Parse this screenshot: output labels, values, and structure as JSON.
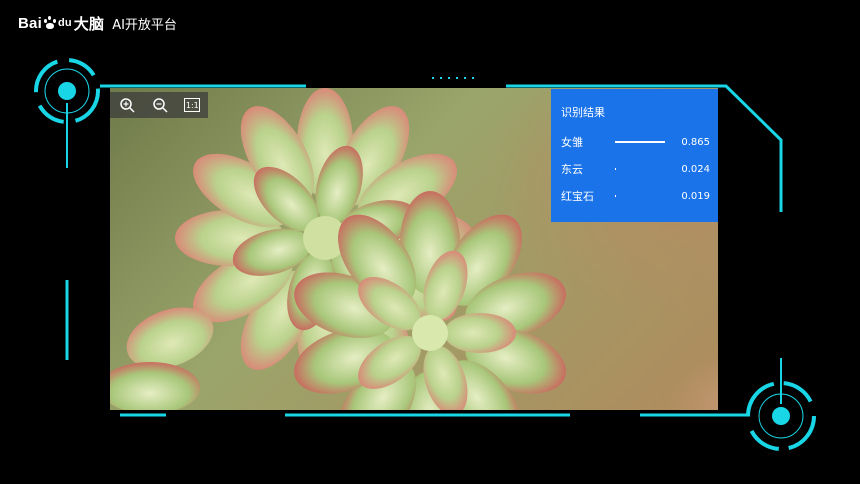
{
  "header": {
    "logo_text_1": "Bai",
    "logo_text_2": "du",
    "logo_text_3": "大脑",
    "subtitle": "AI开放平台"
  },
  "toolbar": {
    "zoom_in": "zoom-in-icon",
    "zoom_out": "zoom-out-icon",
    "actual_size_label": "1:1"
  },
  "results": {
    "title": "识别结果",
    "items": [
      {
        "name": "女雏",
        "score": "0.865",
        "fraction": 0.865
      },
      {
        "name": "东云",
        "score": "0.024",
        "fraction": 0.024
      },
      {
        "name": "红宝石",
        "score": "0.019",
        "fraction": 0.019
      }
    ]
  },
  "colors": {
    "accent_cyan": "#19d6e6",
    "result_panel": "#1a73e8"
  }
}
